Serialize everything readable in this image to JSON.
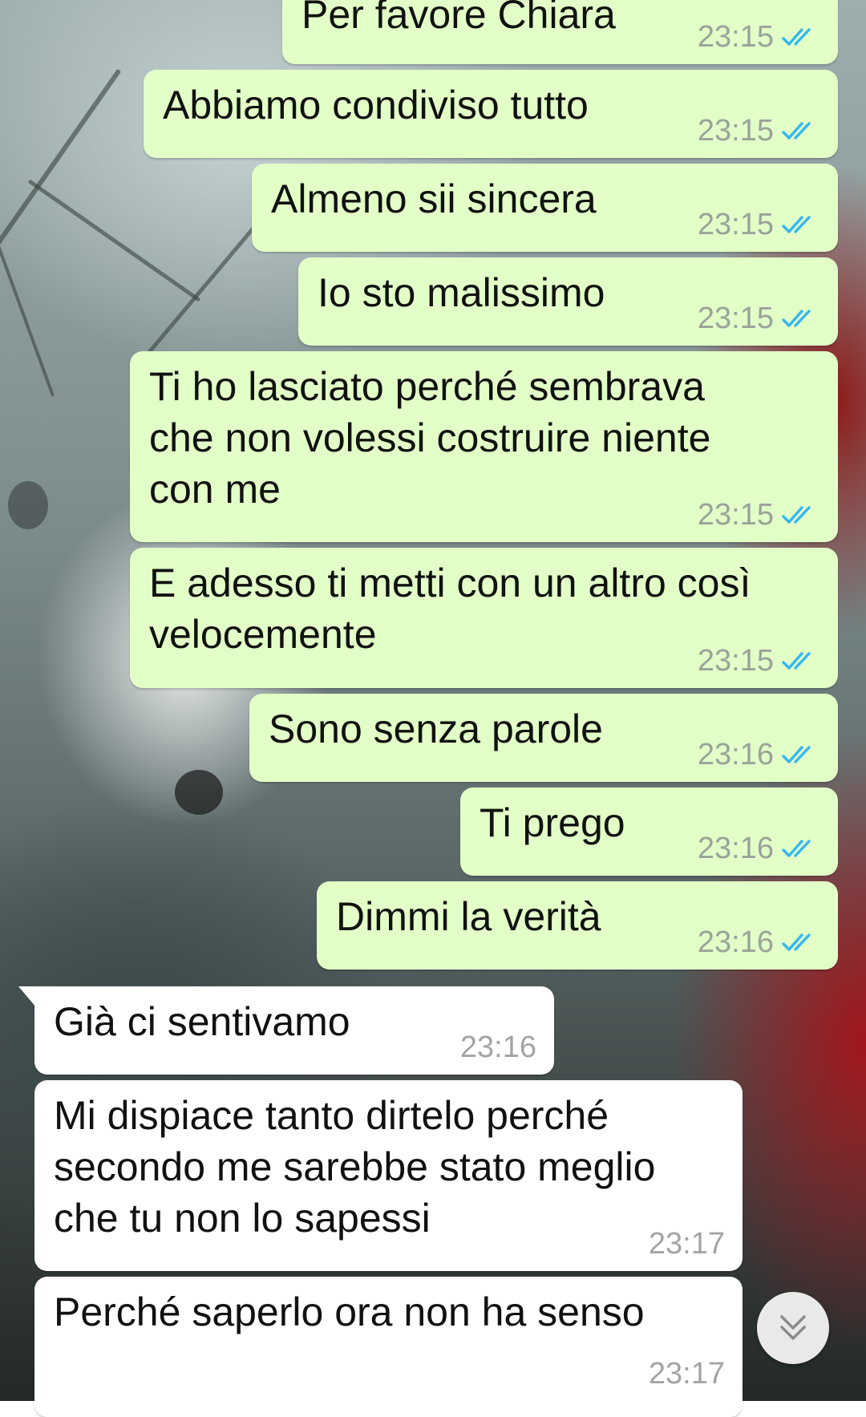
{
  "messages": [
    {
      "direction": "outgoing",
      "lines": [
        "Per favore Chiara"
      ],
      "time": "23:15",
      "status": "read"
    },
    {
      "direction": "outgoing",
      "lines": [
        "Abbiamo condiviso tutto"
      ],
      "time": "23:15",
      "status": "read"
    },
    {
      "direction": "outgoing",
      "lines": [
        "Almeno sii sincera"
      ],
      "time": "23:15",
      "status": "read"
    },
    {
      "direction": "outgoing",
      "lines": [
        "Io sto malissimo"
      ],
      "time": "23:15",
      "status": "read"
    },
    {
      "direction": "outgoing",
      "lines": [
        "Ti ho lasciato perché sembrava",
        "che non volessi costruire niente",
        "con me"
      ],
      "time": "23:15",
      "status": "read"
    },
    {
      "direction": "outgoing",
      "lines": [
        "E adesso ti metti con un altro così",
        "velocemente"
      ],
      "time": "23:15",
      "status": "read"
    },
    {
      "direction": "outgoing",
      "lines": [
        "Sono senza parole"
      ],
      "time": "23:16",
      "status": "read"
    },
    {
      "direction": "outgoing",
      "lines": [
        "Ti prego"
      ],
      "time": "23:16",
      "status": "read"
    },
    {
      "direction": "outgoing",
      "lines": [
        "Dimmi la verità"
      ],
      "time": "23:16",
      "status": "read"
    },
    {
      "direction": "incoming",
      "lines": [
        "Già ci sentivamo"
      ],
      "time": "23:16"
    },
    {
      "direction": "incoming",
      "lines": [
        "Mi dispiace tanto dirtelo perché",
        "secondo me sarebbe stato meglio",
        "che tu non lo sapessi"
      ],
      "time": "23:17"
    },
    {
      "direction": "incoming",
      "lines": [
        "Perché saperlo ora non ha senso"
      ],
      "time": "23:17"
    }
  ],
  "icons": {
    "read_receipt": "double-check-icon",
    "scroll_down": "double-chevron-down-icon"
  },
  "colors": {
    "outgoing_bubble": "#e2ffc7",
    "incoming_bubble": "#ffffff",
    "read_tick": "#34b7f1",
    "timestamp": "#9aa39a"
  }
}
